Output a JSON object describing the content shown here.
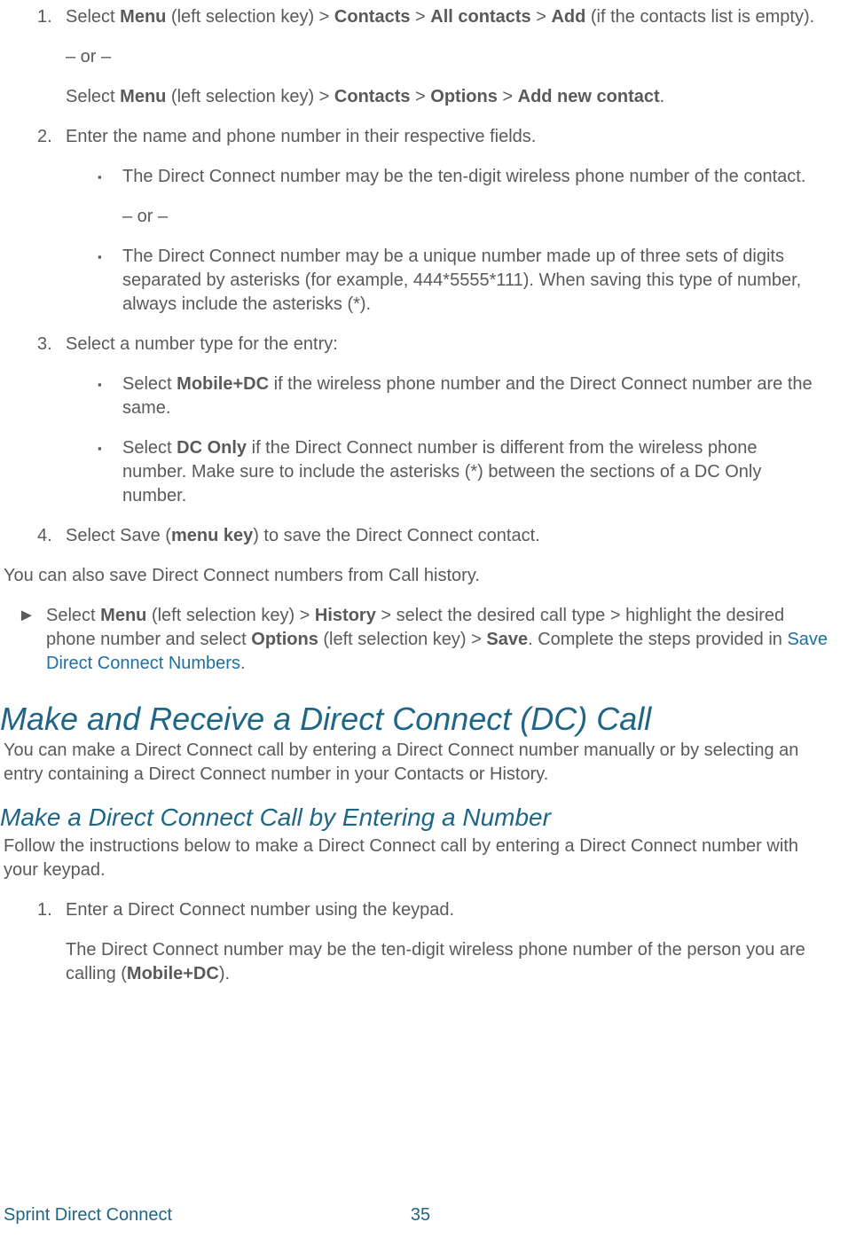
{
  "steps1": {
    "num1": "1.",
    "s1a_pre": "Select ",
    "s1a_b1": "Menu",
    "s1a_mid1": " (left selection key) > ",
    "s1a_b2": "Contacts",
    "s1a_gt1": " > ",
    "s1a_b3": "All contacts",
    "s1a_gt2": " > ",
    "s1a_b4": "Add",
    "s1a_post": " (if the contacts list is empty).",
    "or1": "– or –",
    "s1b_pre": "Select ",
    "s1b_b1": "Menu",
    "s1b_mid1": " (left selection key) > ",
    "s1b_b2": "Contacts",
    "s1b_gt1": " > ",
    "s1b_b3": "Options",
    "s1b_gt2": " > ",
    "s1b_b4": "Add new contact",
    "s1b_post": ".",
    "num2": "2.",
    "s2_text": " Enter the name and phone number in their respective fields.",
    "s2_sub1": "The Direct Connect number may be the ten-digit wireless phone number of the contact.",
    "or2": "– or –",
    "s2_sub2": "The Direct Connect number may be a unique number made up of three sets of digits separated by asterisks (for example, 444*5555*111). When saving this type of number, always include the asterisks (*).",
    "num3": "3.",
    "s3_text": "Select a number type for the entry:",
    "s3_sub1_pre": "Select ",
    "s3_sub1_b": "Mobile+DC",
    "s3_sub1_post": " if the wireless phone number and the Direct Connect number are the same.",
    "s3_sub2_pre": "Select ",
    "s3_sub2_b": "DC Only",
    "s3_sub2_post": " if the Direct Connect number is different from the wireless phone number. Make sure to include the asterisks (*) between the sections of a DC Only number.",
    "num4": "4.",
    "s4_pre": "Select Save (",
    "s4_b": "menu key",
    "s4_post": ") to save the Direct Connect contact."
  },
  "after_steps": "You can also save Direct Connect numbers from Call history.",
  "arrow": {
    "mark": "►",
    "pre": "Select ",
    "b1": "Menu",
    "mid1": " (left selection key) > ",
    "b2": "History",
    "mid2": " > select the desired call type > highlight the desired phone number and select ",
    "b3": "Options",
    "mid3": " (left selection key) > ",
    "b4": "Save",
    "mid4": ". Complete the steps provided in ",
    "link": "Save Direct Connect Numbers",
    "post": "."
  },
  "h1": "Make and Receive a Direct Connect (DC) Call",
  "h1_after": "You can make a Direct Connect call by entering a Direct Connect number manually or by selecting an entry containing a Direct Connect number in your Contacts or History.",
  "h2": "Make a Direct Connect Call by Entering a Number",
  "h2_after": "Follow the instructions below to make a Direct Connect call by entering a Direct Connect number with your keypad.",
  "steps2": {
    "num1": "1.",
    "s1": "Enter a Direct Connect number using the keypad.",
    "s1p_pre": "The Direct Connect number may be the ten-digit wireless phone number of the person you are calling (",
    "s1p_b": "Mobile+DC",
    "s1p_post": ")."
  },
  "footer": {
    "title": "Sprint Direct Connect",
    "page": "35"
  },
  "bullet": "▪"
}
